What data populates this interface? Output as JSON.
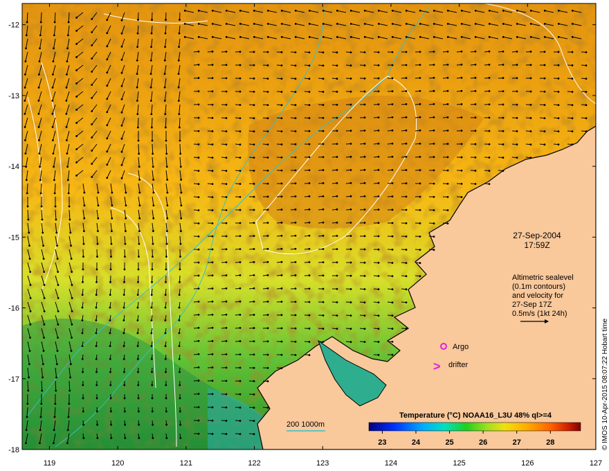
{
  "map": {
    "lon_range": [
      118.6,
      127.0
    ],
    "lat_range": [
      -18.0,
      -11.7
    ],
    "x_ticks": [
      119,
      120,
      121,
      122,
      123,
      124,
      125,
      126,
      127
    ],
    "x_tick_labels": [
      "119",
      "120",
      "121",
      "122",
      "123",
      "124",
      "125",
      "126",
      "127"
    ],
    "y_ticks": [
      -12,
      -13,
      -14,
      -15,
      -16,
      -17,
      -18
    ],
    "y_tick_labels": [
      "-12",
      "-13",
      "-14",
      "-15",
      "-16",
      "-17",
      "-18"
    ],
    "colors": {
      "land": "#f9c89b",
      "coastline": "#000000",
      "sealevel_contour": "#ffffff",
      "isobath": "#35c1c9",
      "vector": "#000000",
      "marker": "#e020e0"
    }
  },
  "annotations": {
    "date": "27-Sep-2004",
    "time": "17:59Z",
    "legend_lines": [
      "Altimetric sealevel",
      "(0.1m contours)",
      "and velocity for",
      "27-Sep 17Z",
      "0.5m/s (1kt 24h)"
    ],
    "argo_label": "Argo",
    "drifter_label": "drifter",
    "drifter_symbol": ">",
    "isobath_label": "200  1000m",
    "credit": "© IMOS 10-Apr-2015 08:07:22 Hobart time"
  },
  "colorbar": {
    "title": "Temperature (°C) NOAA16_L3U 48% ql>=4",
    "range": [
      22.6,
      28.9
    ],
    "ticks": [
      23,
      24,
      25,
      26,
      27,
      28
    ],
    "tick_labels": [
      "23",
      "24",
      "25",
      "26",
      "27",
      "28"
    ]
  }
}
